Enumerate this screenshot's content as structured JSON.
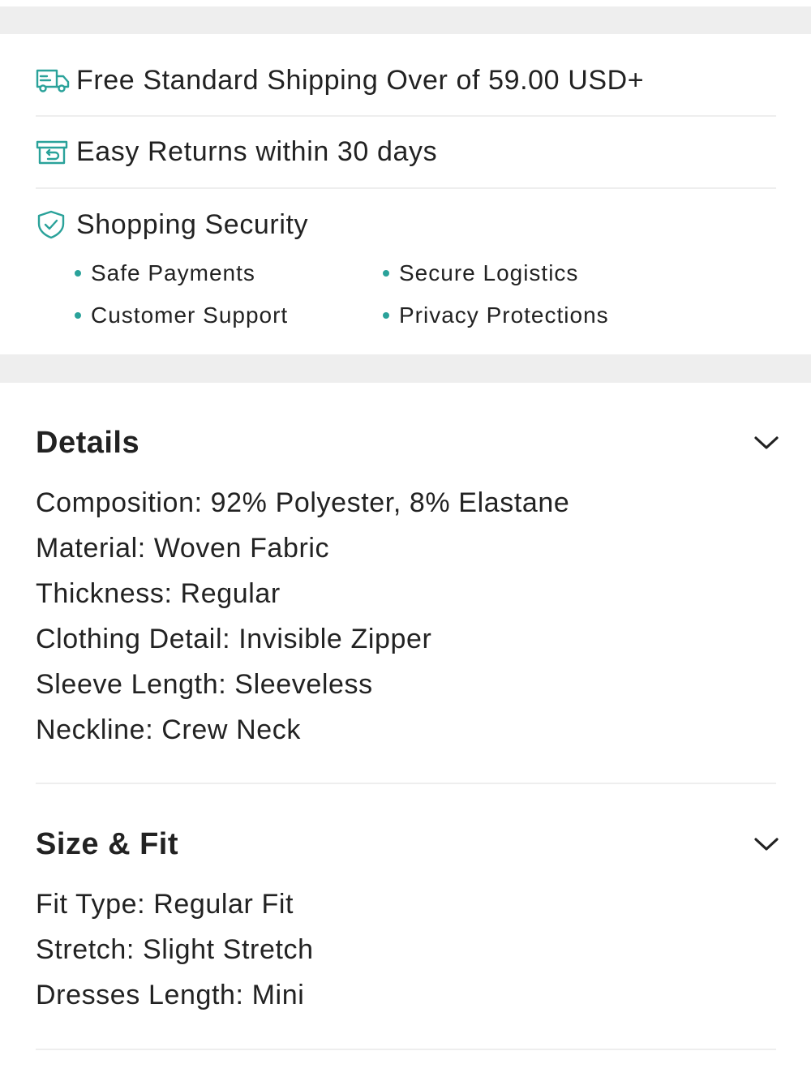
{
  "benefits": {
    "shipping": {
      "icon": "truck-icon",
      "text": "Free Standard Shipping Over of 59.00 USD+"
    },
    "returns": {
      "icon": "return-box-icon",
      "text": "Easy Returns within 30 days"
    },
    "security": {
      "icon": "shield-check-icon",
      "title": "Shopping Security",
      "items": [
        "Safe Payments",
        "Secure Logistics",
        "Customer Support",
        "Privacy Protections"
      ]
    }
  },
  "details": {
    "title": "Details",
    "toggle_icon": "chevron-down-icon",
    "rows": [
      "Composition: 92% Polyester, 8% Elastane",
      "Material: Woven Fabric",
      "Thickness: Regular",
      "Clothing Detail: Invisible Zipper",
      "Sleeve Length: Sleeveless",
      "Neckline: Crew Neck"
    ]
  },
  "size_fit": {
    "title": "Size & Fit",
    "toggle_icon": "chevron-down-icon",
    "rows": [
      "Fit Type: Regular Fit",
      "Stretch: Slight Stretch",
      "Dresses Length: Mini"
    ]
  },
  "colors": {
    "accent": "#2aa29a",
    "divider": "#eeeeee",
    "text": "#222222"
  }
}
